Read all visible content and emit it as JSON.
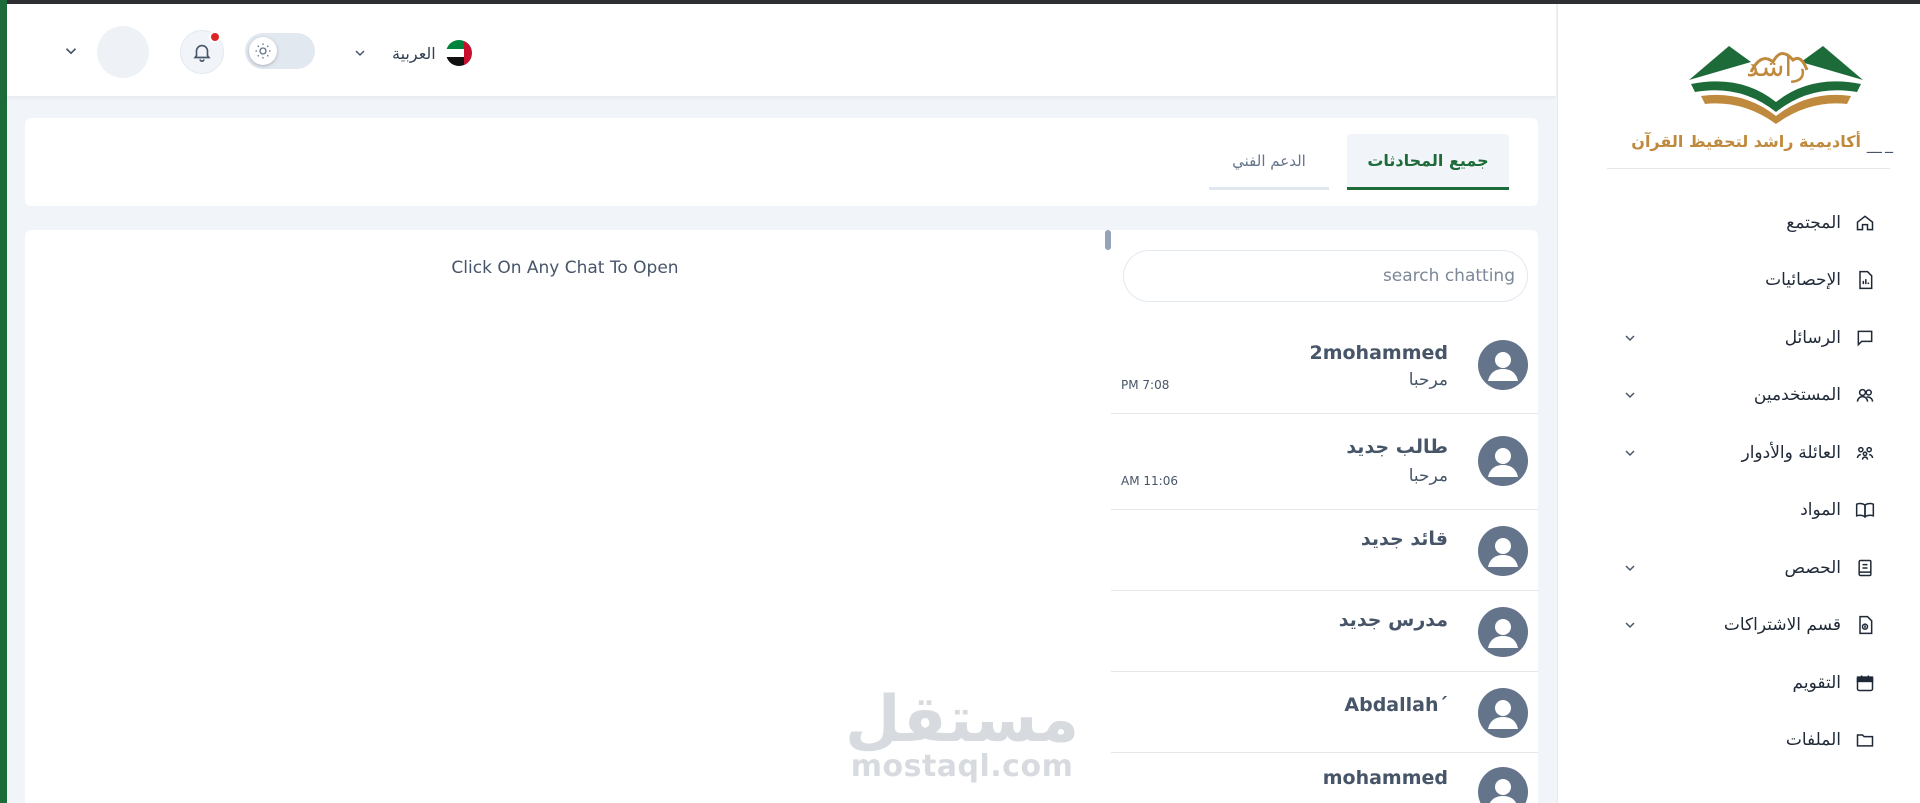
{
  "header": {
    "language": "العربية",
    "flag_icon": "uae-flag-icon",
    "theme_icon": "sun-icon",
    "notification_icon": "bell-icon"
  },
  "sidebar": {
    "logo_text": "أكاديمية راشد لتحفيظ القرآن",
    "logo_mark": "راشد",
    "collapse_marks": "__ _",
    "items": [
      {
        "label": "المجتمع",
        "icon": "home-icon",
        "has_submenu": false
      },
      {
        "label": "الإحصائيات",
        "icon": "stats-file-icon",
        "has_submenu": false
      },
      {
        "label": "الرسائل",
        "icon": "chat-icon",
        "has_submenu": true
      },
      {
        "label": "المستخدمين",
        "icon": "users-icon",
        "has_submenu": true
      },
      {
        "label": "العائلة والأدوار",
        "icon": "family-icon",
        "has_submenu": true
      },
      {
        "label": "المواد",
        "icon": "book-icon",
        "has_submenu": false
      },
      {
        "label": "الحصص",
        "icon": "notebook-icon",
        "has_submenu": true
      },
      {
        "label": "قسم الاشتراكات",
        "icon": "subscription-file-icon",
        "has_submenu": true
      },
      {
        "label": "التقويم",
        "icon": "calendar-icon",
        "has_submenu": false
      },
      {
        "label": "الملفات",
        "icon": "folder-icon",
        "has_submenu": false
      }
    ]
  },
  "tabs": [
    {
      "label": "جميع المحادثات",
      "active": true
    },
    {
      "label": "الدعم الفني",
      "active": false
    }
  ],
  "chat": {
    "empty_text": "Click On Any Chat To Open",
    "search_placeholder": "search chatting",
    "conversations": [
      {
        "name": "2mohammed",
        "preview": "مرحبا",
        "time": "PM 7:08"
      },
      {
        "name": "طالب جديد",
        "preview": "مرحبا",
        "time": "AM 11:06"
      },
      {
        "name": "قائد جديد",
        "preview": "",
        "time": ""
      },
      {
        "name": "مدرس جديد",
        "preview": "",
        "time": ""
      },
      {
        "name": "Abdallah´",
        "preview": "",
        "time": ""
      },
      {
        "name": "mohammed",
        "preview": "",
        "time": ""
      }
    ]
  },
  "watermark": {
    "arabic": "مستقل",
    "latin": "mostaql.com"
  }
}
